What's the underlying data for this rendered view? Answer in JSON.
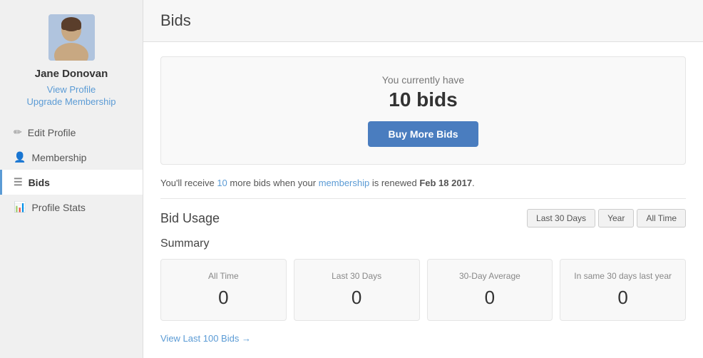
{
  "sidebar": {
    "user_name": "Jane Donovan",
    "view_profile_label": "View Profile",
    "upgrade_label": "Upgrade Membership",
    "nav_items": [
      {
        "id": "edit-profile",
        "label": "Edit Profile",
        "icon": "✏",
        "active": false
      },
      {
        "id": "membership",
        "label": "Membership",
        "icon": "👤",
        "active": false
      },
      {
        "id": "bids",
        "label": "Bids",
        "icon": "≡",
        "active": true
      },
      {
        "id": "profile-stats",
        "label": "Profile Stats",
        "icon": "📊",
        "active": false
      }
    ]
  },
  "main": {
    "title": "Bids",
    "bids_card": {
      "subtitle": "You currently have",
      "count": "10 bids",
      "buy_button": "Buy More Bids"
    },
    "renewal_notice": "You'll receive 10 more bids when your membership is renewed Feb 18 2017.",
    "renewal_highlight": "membership",
    "bid_usage": {
      "title": "Bid Usage",
      "filters": [
        {
          "label": "Last 30 Days",
          "active": false
        },
        {
          "label": "Year",
          "active": false
        },
        {
          "label": "All Time",
          "active": false
        }
      ]
    },
    "summary": {
      "title": "Summary",
      "cards": [
        {
          "label": "All Time",
          "value": "0"
        },
        {
          "label": "Last 30 Days",
          "value": "0"
        },
        {
          "label": "30-Day Average",
          "value": "0"
        },
        {
          "label": "In same 30 days last year",
          "value": "0"
        }
      ]
    },
    "view_bids_label": "View Last 100 Bids →"
  }
}
